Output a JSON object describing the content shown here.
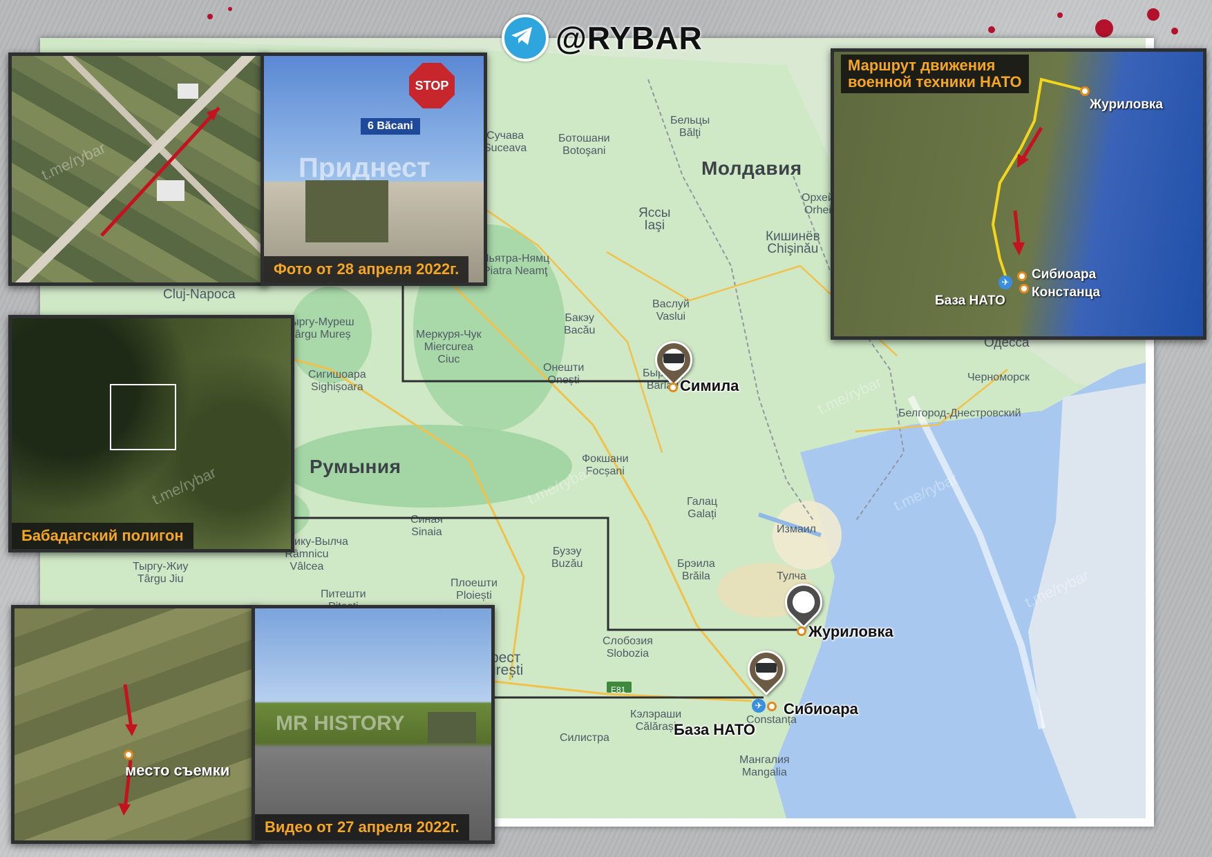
{
  "header": {
    "handle": "@RYBAR",
    "icon": "telegram-icon"
  },
  "watermark": "t.me/rybar",
  "map": {
    "countries": {
      "moldova": "Молдавия",
      "romania": "Румыния"
    },
    "places": {
      "cluj": "Cluj-Napoca",
      "suceava": "Сучава\nSuceava",
      "botosani": "Ботошани\nBotoşani",
      "beltsy": "Бельцы\nBălţi",
      "iasi": "Яссы\nIaşi",
      "kishinev": "Кишинёв\nChişinău",
      "orhei": "Орхей\nOrhei",
      "piatra": "Пьятра-Нямц\nPiatra Neamţ",
      "vaslui": "Васлуй\nVaslui",
      "bacau": "Бакэу\nBacău",
      "tirgu_mures": "Тыргу-Муреш\nTârgu Mureș",
      "miercurea": "Меркуря-Чук\nMiercurea\nCiuc",
      "onesti": "Онешти\nOnești",
      "sighisoara": "Сигишоара\nSighișoara",
      "barlad": "Бырлад\nBârlad",
      "odessa": "Одесса",
      "chernomorsk": "Черноморск",
      "belgorod": "Белгород-Днестровский",
      "focsani": "Фокшани\nFocșani",
      "galati": "Галац\nGalați",
      "izmail": "Измаил",
      "sinaia": "Синая\nSinaia",
      "ramnicu": "Рымнику-Вылча\nRâmnicu\nVâlcea",
      "targu_jiu": "Тыргу-Жиу\nTârgu Jiu",
      "pitesti": "Питешти\nPitești",
      "ploiesti": "Плоешти\nPloiești",
      "buzau": "Бузэу\nBuzău",
      "braila": "Брэила\nBrăila",
      "tulcea": "Тулча",
      "slobozia": "Слобозия\nSlobozia",
      "bucharest": "рест\nurești",
      "calarasi": "Кэлэраши\nCălărași",
      "silistra": "Силистра",
      "mangalia": "Мангалия\nMangalia",
      "constanta": "Constanța",
      "e81": "E81"
    },
    "callouts": {
      "simila": "Симила",
      "jurilovca": "Журиловка",
      "sibioara": "Сибиоара",
      "nato_base": "База НАТО"
    }
  },
  "insets": {
    "photo_caption": "Фото от 28 апреля 2022г.",
    "photo_sign_text": "6 Băcani",
    "photo_stop_text": "STOP",
    "photo_overlay_text": "Приднест",
    "polygon_caption": "Бабадагский полигон",
    "video_caption": "Видео от 27 апреля 2022г.",
    "video_location_label": "место съемки",
    "video_overlay_text": "MR HISTORY"
  },
  "route_inset": {
    "title": "Маршрут движения\nвоенной техники НАТО",
    "labels": {
      "jurilovca": "Журиловка",
      "sibioara": "Сибиоара",
      "constanta": "Констанца",
      "nato_base": "База НАТО"
    }
  },
  "colors": {
    "land": "#cfe8c6",
    "forest": "#9fd3a1",
    "sea": "#a8c8f0",
    "callout_line": "#2d2f31",
    "caption_text": "#f5a623",
    "blood": "#b3122c",
    "route": "#f1d51e",
    "arrow": "#d0202a"
  }
}
